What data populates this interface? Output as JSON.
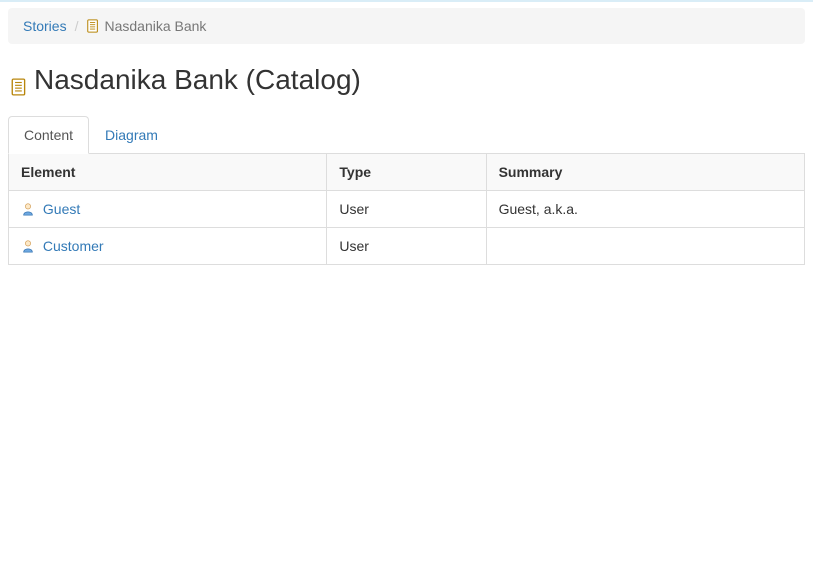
{
  "breadcrumb": {
    "root": "Stories",
    "current": "Nasdanika Bank"
  },
  "page": {
    "title": "Nasdanika Bank (Catalog)"
  },
  "tabs": [
    {
      "label": "Content",
      "active": true
    },
    {
      "label": "Diagram",
      "active": false
    }
  ],
  "table": {
    "headers": {
      "element": "Element",
      "type": "Type",
      "summary": "Summary"
    },
    "rows": [
      {
        "element": "Guest",
        "type": "User",
        "summary": "Guest, a.k.a."
      },
      {
        "element": "Customer",
        "type": "User",
        "summary": ""
      }
    ]
  }
}
